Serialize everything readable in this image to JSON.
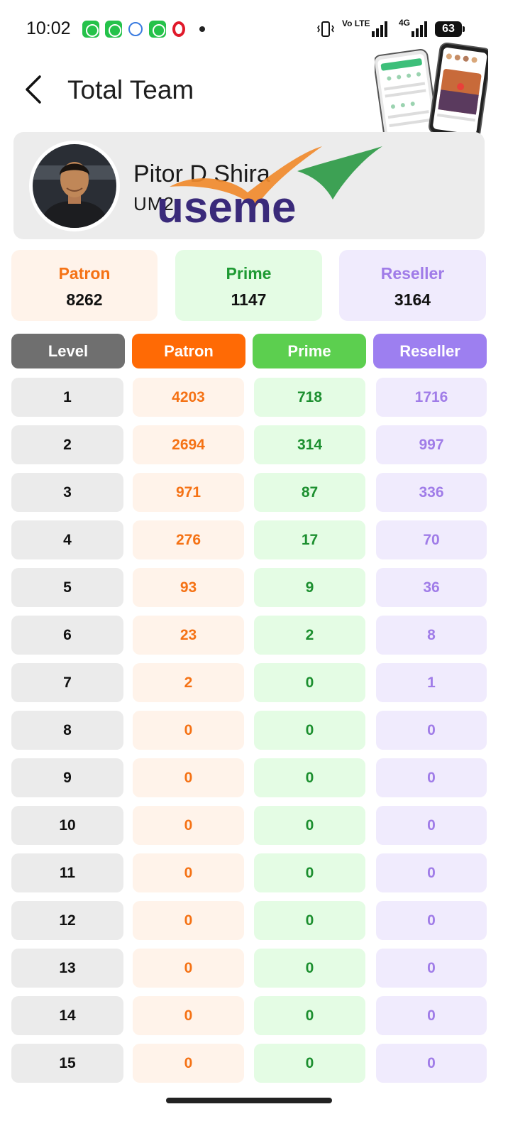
{
  "status_bar": {
    "time": "10:02",
    "network": "Vo LTE",
    "network_2": "4G",
    "battery": "63"
  },
  "header": {
    "title": "Total Team"
  },
  "profile": {
    "name": "Pitor D Shira",
    "user_id": "UM2",
    "logo_text": "useme"
  },
  "summary": [
    {
      "label": "Patron",
      "value": "8262",
      "color": "#f57215",
      "bg": "#fff3ea"
    },
    {
      "label": "Prime",
      "value": "1147",
      "color": "#1e9a33",
      "bg": "#e4fce4"
    },
    {
      "label": "Reseller",
      "value": "3164",
      "color": "#a07ce8",
      "bg": "#f0ebfd"
    }
  ],
  "table": {
    "headers": {
      "level": "Level",
      "patron": "Patron",
      "prime": "Prime",
      "reseller": "Reseller"
    },
    "header_colors": {
      "level": "#6f6f6f",
      "patron": "#ff6a05",
      "prime": "#5ccf4f",
      "reseller": "#9d7ff0"
    },
    "rows": [
      {
        "level": "1",
        "patron": "4203",
        "prime": "718",
        "reseller": "1716"
      },
      {
        "level": "2",
        "patron": "2694",
        "prime": "314",
        "reseller": "997"
      },
      {
        "level": "3",
        "patron": "971",
        "prime": "87",
        "reseller": "336"
      },
      {
        "level": "4",
        "patron": "276",
        "prime": "17",
        "reseller": "70"
      },
      {
        "level": "5",
        "patron": "93",
        "prime": "9",
        "reseller": "36"
      },
      {
        "level": "6",
        "patron": "23",
        "prime": "2",
        "reseller": "8"
      },
      {
        "level": "7",
        "patron": "2",
        "prime": "0",
        "reseller": "1"
      },
      {
        "level": "8",
        "patron": "0",
        "prime": "0",
        "reseller": "0"
      },
      {
        "level": "9",
        "patron": "0",
        "prime": "0",
        "reseller": "0"
      },
      {
        "level": "10",
        "patron": "0",
        "prime": "0",
        "reseller": "0"
      },
      {
        "level": "11",
        "patron": "0",
        "prime": "0",
        "reseller": "0"
      },
      {
        "level": "12",
        "patron": "0",
        "prime": "0",
        "reseller": "0"
      },
      {
        "level": "13",
        "patron": "0",
        "prime": "0",
        "reseller": "0"
      },
      {
        "level": "14",
        "patron": "0",
        "prime": "0",
        "reseller": "0"
      },
      {
        "level": "15",
        "patron": "0",
        "prime": "0",
        "reseller": "0"
      }
    ]
  }
}
